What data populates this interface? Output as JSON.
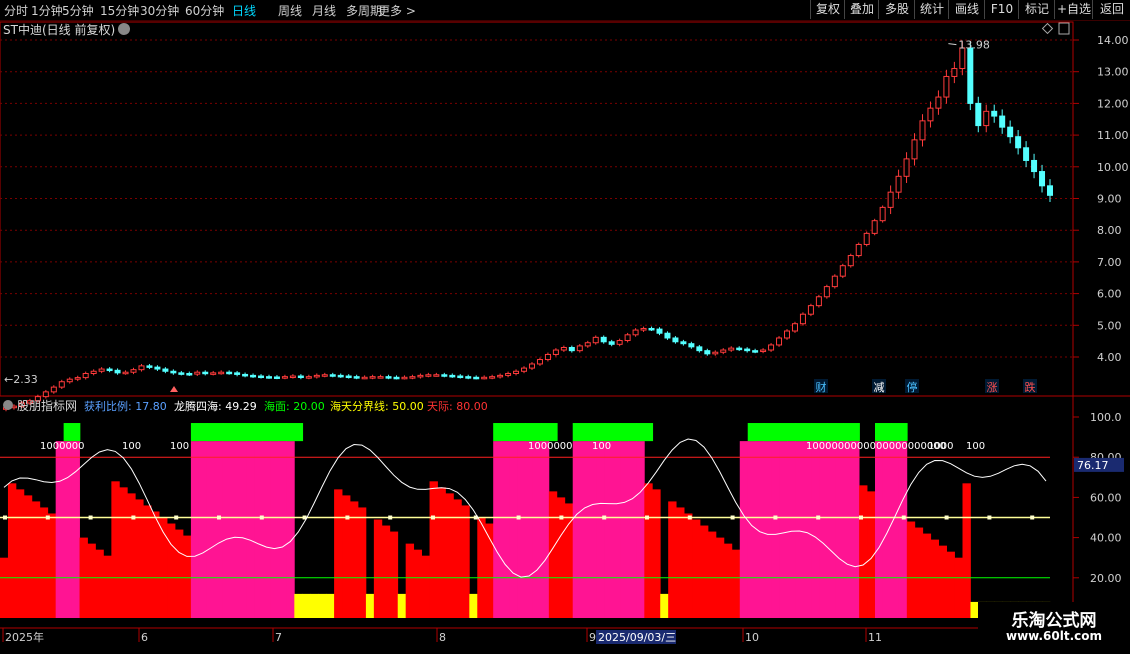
{
  "toolbar": {
    "periods": [
      "分时",
      "1分钟",
      "5分钟",
      "15分钟",
      "30分钟",
      "60分钟",
      "日线",
      "周线",
      "月线",
      "多周期",
      "更多 >"
    ],
    "active_period": "日线",
    "right_buttons": [
      "复权",
      "叠加",
      "多股",
      "统计",
      "画线",
      "F10",
      "标记",
      "+自选",
      "返回"
    ]
  },
  "main_chart": {
    "title": "ST中迪(日线 前复权)",
    "high_label": "13.98",
    "low_label": "2.33",
    "y_ticks": [
      "14.00",
      "13.00",
      "12.00",
      "11.00",
      "10.00",
      "9.00",
      "8.00",
      "7.00",
      "6.00",
      "5.00",
      "4.00"
    ],
    "markers": [
      "财",
      "减",
      "停",
      "涨",
      "跌"
    ],
    "colors": {
      "up": "#ff3b3b",
      "down": "#54ffff",
      "grid": "#8b0000"
    }
  },
  "indicator": {
    "name": "股朋指标网",
    "params": [
      {
        "label": "获利比例: 17.80",
        "color": "#5aa0ff"
      },
      {
        "label": "龙腾四海: 49.29",
        "color": "#ffffff"
      },
      {
        "label": "海面: 20.00",
        "color": "#00ff00"
      },
      {
        "label": "海天分界线: 50.00",
        "color": "#ffff00"
      },
      {
        "label": "天际: 80.00",
        "color": "#ff3333"
      }
    ],
    "y_ticks": [
      "100.0",
      "80.00",
      "60.00",
      "40.00",
      "20.00"
    ],
    "current_value": "76.17",
    "bar_labels": [
      "1000000",
      "100",
      "100",
      "1000000",
      "100",
      "1000000000000000000000",
      "1000",
      "100"
    ]
  },
  "x_axis": {
    "labels": [
      "2025年",
      "6",
      "7",
      "8",
      "9",
      "2025/09/03/三",
      "10",
      "11"
    ]
  },
  "watermark": {
    "line1": "乐淘公式网",
    "line2": "www.60lt.com"
  },
  "chart_data": {
    "type": "candlestick",
    "title": "ST中迪(日线 前复权)",
    "ylim": [
      2.2,
      14.6
    ],
    "y_ticks": [
      4,
      5,
      6,
      7,
      8,
      9,
      10,
      11,
      12,
      13,
      14
    ],
    "high": 13.98,
    "low": 2.33,
    "x_axis_months": [
      "2025年",
      "6",
      "7",
      "8",
      "9",
      "10",
      "11"
    ],
    "closes": [
      2.4,
      2.45,
      2.55,
      2.62,
      2.75,
      2.9,
      3.05,
      3.22,
      3.3,
      3.35,
      3.48,
      3.55,
      3.62,
      3.58,
      3.5,
      3.52,
      3.6,
      3.72,
      3.68,
      3.62,
      3.55,
      3.5,
      3.48,
      3.46,
      3.52,
      3.48,
      3.5,
      3.52,
      3.5,
      3.45,
      3.42,
      3.4,
      3.38,
      3.37,
      3.36,
      3.38,
      3.4,
      3.36,
      3.38,
      3.42,
      3.44,
      3.42,
      3.4,
      3.38,
      3.36,
      3.36,
      3.38,
      3.38,
      3.36,
      3.35,
      3.36,
      3.38,
      3.42,
      3.44,
      3.44,
      3.42,
      3.4,
      3.38,
      3.36,
      3.35,
      3.36,
      3.38,
      3.42,
      3.48,
      3.55,
      3.65,
      3.78,
      3.92,
      4.08,
      4.22,
      4.3,
      4.2,
      4.35,
      4.45,
      4.62,
      4.48,
      4.4,
      4.52,
      4.7,
      4.85,
      4.9,
      4.88,
      4.75,
      4.6,
      4.48,
      4.42,
      4.32,
      4.2,
      4.1,
      4.15,
      4.22,
      4.28,
      4.25,
      4.2,
      4.18,
      4.22,
      4.38,
      4.6,
      4.82,
      5.05,
      5.35,
      5.62,
      5.9,
      6.22,
      6.55,
      6.88,
      7.2,
      7.55,
      7.9,
      8.3,
      8.72,
      9.2,
      9.7,
      10.25,
      10.85,
      11.45,
      11.85,
      12.2,
      12.85,
      13.1,
      13.75,
      12.0,
      11.3,
      11.75,
      11.6,
      11.25,
      10.95,
      10.6,
      10.2,
      9.85,
      9.4,
      9.1
    ]
  }
}
